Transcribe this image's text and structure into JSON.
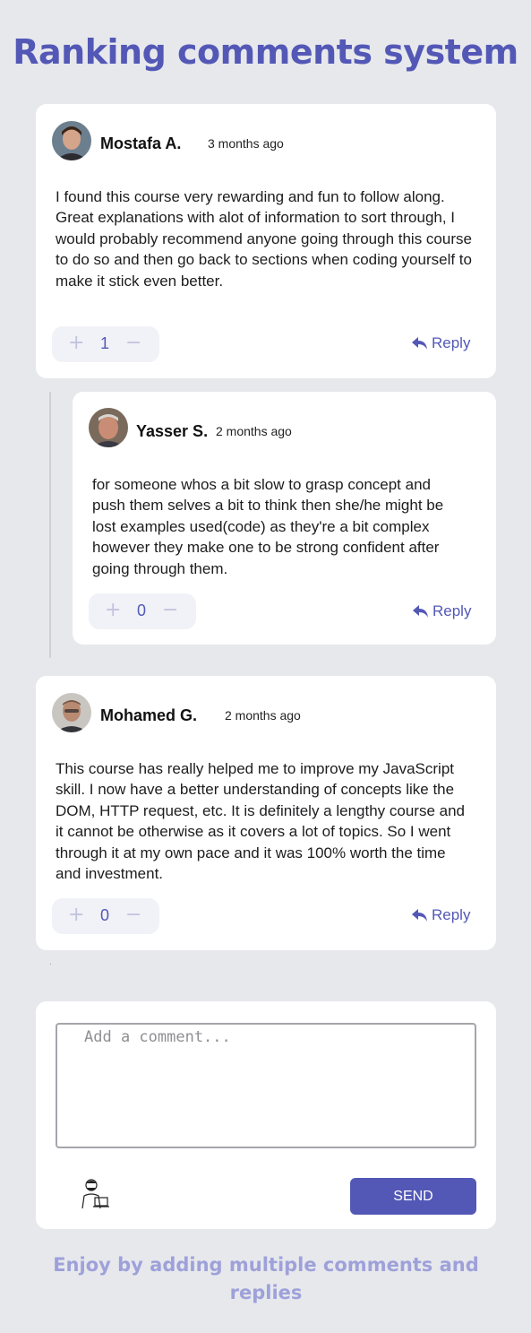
{
  "page": {
    "title": "Ranking comments system",
    "footer": "Enjoy by adding multiple comments and replies"
  },
  "comments": [
    {
      "username": "Mostafa A.",
      "time": "3 months ago",
      "text": "I found this course very rewarding and fun to follow along. Great explanations with alot of information to sort through, I would probably recommend anyone going through this course to do so and then go back to sections when coding yourself to make it stick even better.",
      "score": "1",
      "reply_label": "Reply"
    },
    {
      "username": "Yasser S.",
      "time": "2 months ago",
      "text": "for someone whos a bit slow to grasp concept and push them selves a bit to think then she/he might be lost examples used(code) as they're a bit complex however they make one to be strong confident after going through them.",
      "score": "0",
      "reply_label": "Reply"
    },
    {
      "username": "Mohamed G.",
      "time": "2 months ago",
      "text": "This course has really helped me to improve my JavaScript skill. I now have a better understanding of concepts like the DOM, HTTP request, etc. It is definitely a lengthy course and it cannot be otherwise as it covers a lot of topics. So I went through it at my own pace and it was 100% worth the time and investment.",
      "score": "0",
      "reply_label": "Reply"
    }
  ],
  "composer": {
    "placeholder": "Add a comment...",
    "value": "",
    "send_label": "SEND"
  },
  "icons": {
    "upvote": "plus-icon",
    "downvote": "minus-icon",
    "reply": "reply-arrow-icon"
  },
  "colors": {
    "accent": "#5358b6",
    "background": "#e7e8ec",
    "footer_text": "#9ea1d9"
  }
}
